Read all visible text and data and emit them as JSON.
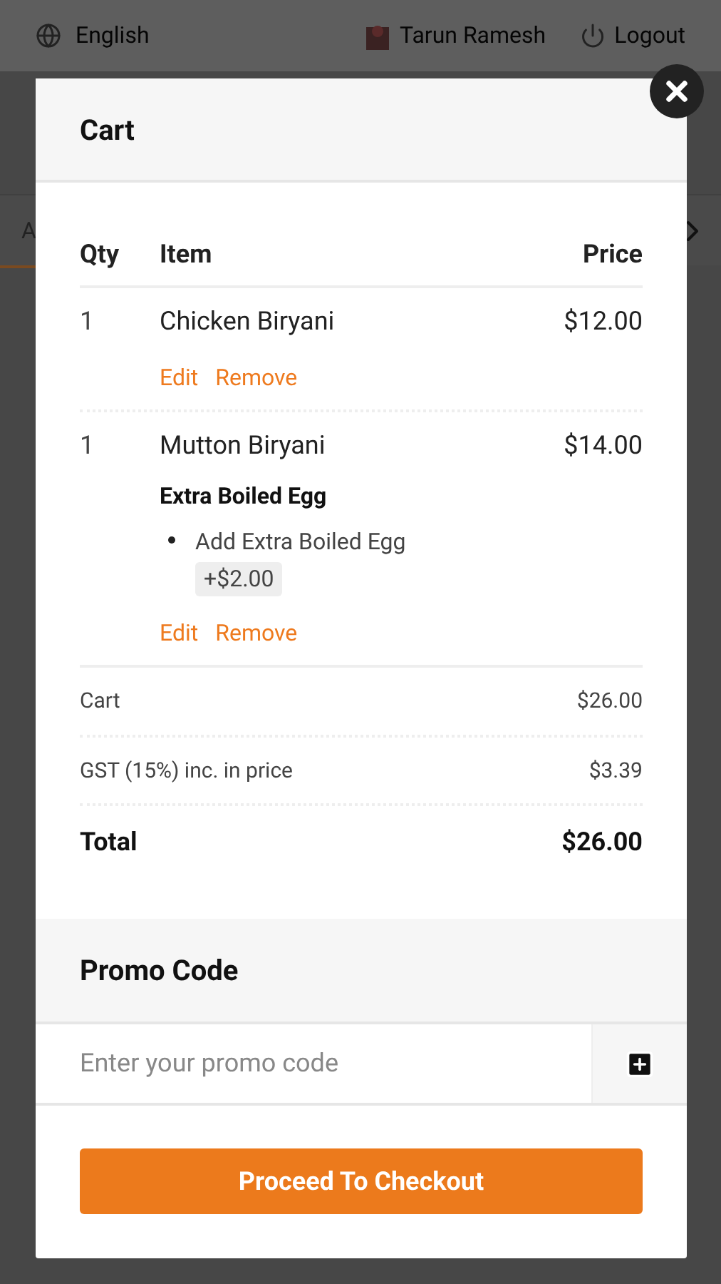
{
  "top_bar": {
    "language": "English",
    "user": "Tarun Ramesh",
    "logout": "Logout"
  },
  "tab_bar": {
    "tab_fragment": "A"
  },
  "cart": {
    "title": "Cart",
    "columns": [
      "Qty",
      "Item",
      "Price"
    ],
    "items": [
      {
        "qty": "1",
        "name": "Chicken Biryani",
        "price": "$12.00",
        "actions": [
          "Edit",
          "Remove"
        ]
      },
      {
        "qty": "1",
        "name": "Mutton Biryani",
        "price": "$14.00",
        "option_group": "Extra Boiled Egg",
        "options": [
          {
            "name": "Add Extra Boiled Egg",
            "price": "+$2.00"
          }
        ],
        "actions": [
          "Edit",
          "Remove"
        ]
      }
    ],
    "summary": [
      {
        "kind": "line",
        "label": "Cart",
        "value": "$26.00"
      },
      {
        "kind": "line",
        "label": "GST (15%) inc. in price",
        "value": "$3.39"
      },
      {
        "kind": "total",
        "label": "Total",
        "value": "$26.00"
      }
    ]
  },
  "promo": {
    "title": "Promo Code",
    "placeholder": "Enter your promo code"
  },
  "checkout_button": "Proceed To Checkout"
}
